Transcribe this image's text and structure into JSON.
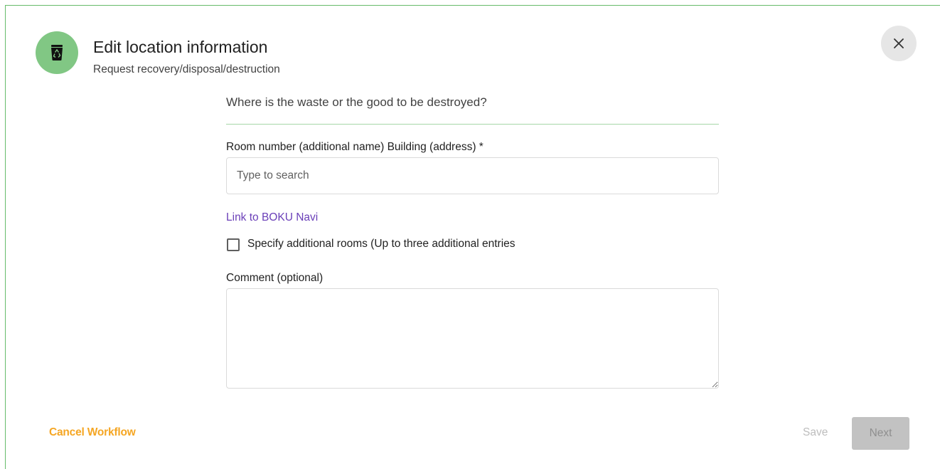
{
  "dialog": {
    "title": "Edit location information",
    "subtitle": "Request recovery/disposal/destruction",
    "icon": "recycling-bin-icon",
    "close_icon": "close-icon"
  },
  "form": {
    "question": "Where is the waste or the good to be destroyed?",
    "room_label": "Room number (additional name) Building (address) *",
    "room_placeholder": "Type to search",
    "room_value": "",
    "navi_link": "Link to BOKU Navi",
    "additional_rooms_label": "Specify additional rooms (Up to three additional entries",
    "additional_rooms_checked": false,
    "comment_label": "Comment (optional)",
    "comment_value": ""
  },
  "footer": {
    "cancel_label": "Cancel Workflow",
    "save_label": "Save",
    "next_label": "Next"
  },
  "colors": {
    "accent_green": "#81c784",
    "cancel_orange": "#f5a623",
    "link_purple": "#6a3fb8",
    "divider_green": "#a5d6a7"
  }
}
